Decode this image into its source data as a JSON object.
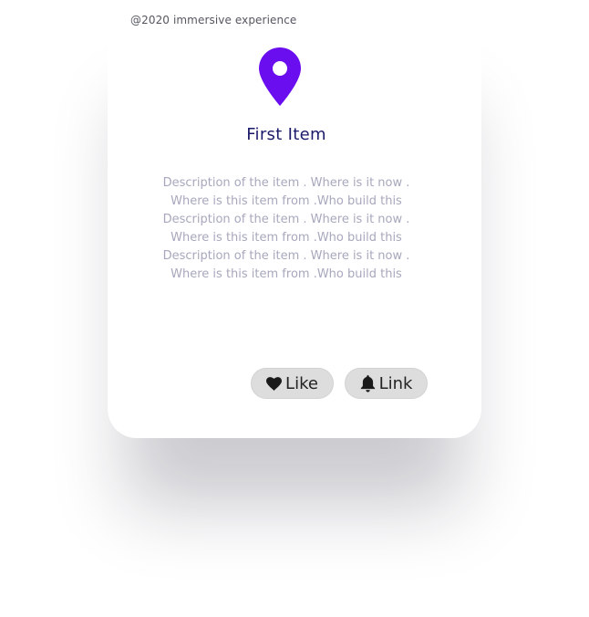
{
  "footer": {
    "copyright": "@2020 immersive experience"
  },
  "card": {
    "icon": "location-pin-icon",
    "title": "First Item",
    "description": "Description of the item . Where is it now . Where is this item from .Who build this Description of the item . Where is it now . Where is this item from .Who build this Description of the item . Where is it now . Where is this item from .Who build this",
    "actions": {
      "like_label": "Like",
      "like_icon": "heart-icon",
      "link_label": "Link",
      "link_icon": "bell-icon"
    }
  },
  "colors": {
    "accent": "#6a0ef0",
    "title": "#1c1a6a",
    "description": "#a7a8bd",
    "button_bg": "#dddddd"
  }
}
